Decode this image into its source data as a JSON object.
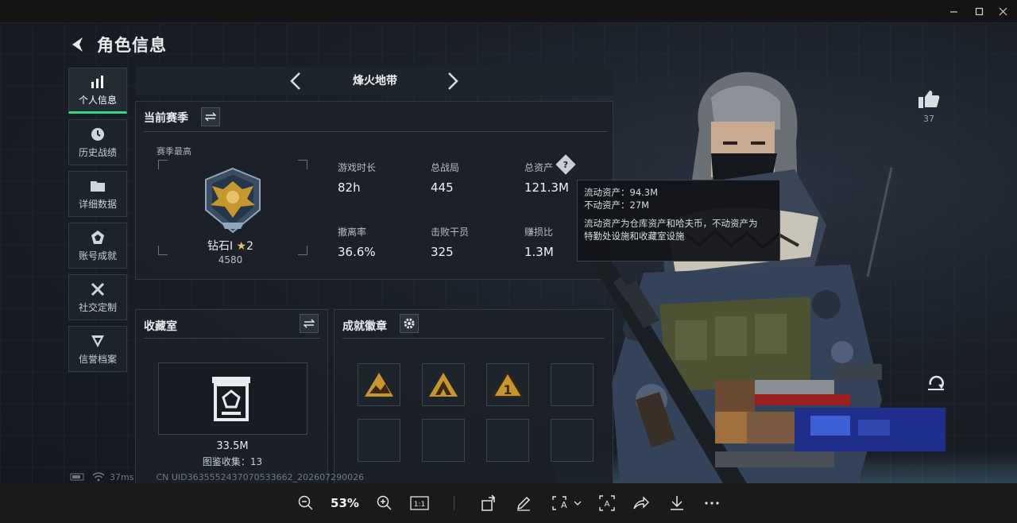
{
  "window": {
    "minimize": "—",
    "maximize": "☐",
    "close": "✕"
  },
  "header": {
    "title": "角色信息"
  },
  "sidebar": {
    "items": [
      {
        "label": "个人信息",
        "icon": "bar-chart-icon",
        "active": true
      },
      {
        "label": "历史战绩",
        "icon": "clock-icon"
      },
      {
        "label": "详细数据",
        "icon": "folder-icon"
      },
      {
        "label": "账号成就",
        "icon": "medal-icon"
      },
      {
        "label": "社交定制",
        "icon": "tools-icon"
      },
      {
        "label": "信誉档案",
        "icon": "shield-icon"
      }
    ]
  },
  "mode": {
    "name": "烽火地带"
  },
  "season": {
    "title": "当前赛季",
    "best_label": "赛季最高",
    "rank_name": "钻石I",
    "rank_stars": "2",
    "rank_score": "4580",
    "stats": [
      {
        "label": "游戏时长",
        "value": "82h"
      },
      {
        "label": "总战局",
        "value": "445"
      },
      {
        "label": "总资产",
        "value": "121.3M"
      },
      {
        "label": "撤离率",
        "value": "36.6%"
      },
      {
        "label": "击败干员",
        "value": "325"
      },
      {
        "label": "赚损比",
        "value": "1.3M"
      }
    ]
  },
  "asset_tooltip": {
    "liquid": "流动资产：94.3M",
    "fixed": "不动资产：27M",
    "desc_line1": "流动资产为仓库资产和哈夫币，不动资产为",
    "desc_line2": "特勤处设施和收藏室设施"
  },
  "collection": {
    "title": "收藏室",
    "value": "33.5M",
    "count_text": "图鉴收集：13"
  },
  "achievements": {
    "title": "成就徽章",
    "badge_count": 3,
    "slot_count": 8
  },
  "like": {
    "count": "37"
  },
  "status": {
    "ping": "37ms",
    "uid": "CN UID36355524370705336​62_202607290026"
  },
  "toolbar": {
    "zoom": "53%",
    "actual_size": "1:1"
  },
  "colors": {
    "accent_green": "#38d487",
    "badge_gold": "#c8962f"
  }
}
